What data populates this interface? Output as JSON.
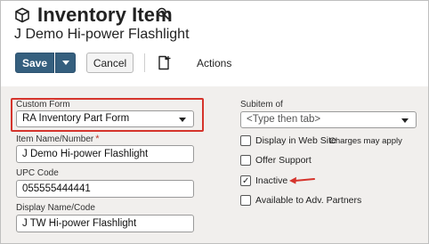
{
  "header": {
    "title": "Inventory Item",
    "record_name": "J Demo Hi-power Flashlight",
    "icons": [
      "cube-icon",
      "search-icon"
    ]
  },
  "toolbar": {
    "save_label": "Save",
    "cancel_label": "Cancel",
    "actions_label": "Actions",
    "icons": [
      "chevron-down-icon",
      "document-icon"
    ]
  },
  "form": {
    "custom_form": {
      "label": "Custom Form",
      "value": "RA Inventory Part Form"
    },
    "item_name": {
      "label": "Item Name/Number",
      "required_mark": "*",
      "value": "J Demo Hi-power Flashlight"
    },
    "upc_code": {
      "label": "UPC Code",
      "value": "055555444441"
    },
    "display_name": {
      "label": "Display Name/Code",
      "value": "J TW Hi-power Flashlight"
    },
    "subitem_of": {
      "label": "Subitem of",
      "placeholder": "<Type then tab>"
    },
    "checkboxes": [
      {
        "label": "Display in Web Site",
        "checked": false,
        "note": "Charges may apply"
      },
      {
        "label": "Offer Support",
        "checked": false
      },
      {
        "label": "Inactive",
        "checked": true,
        "check_glyph": "✓"
      },
      {
        "label": "Available to Adv. Partners",
        "checked": false
      }
    ]
  },
  "colors": {
    "primary_button": "#355f7e",
    "highlight": "#d5342c",
    "form_background": "#f1efed"
  }
}
